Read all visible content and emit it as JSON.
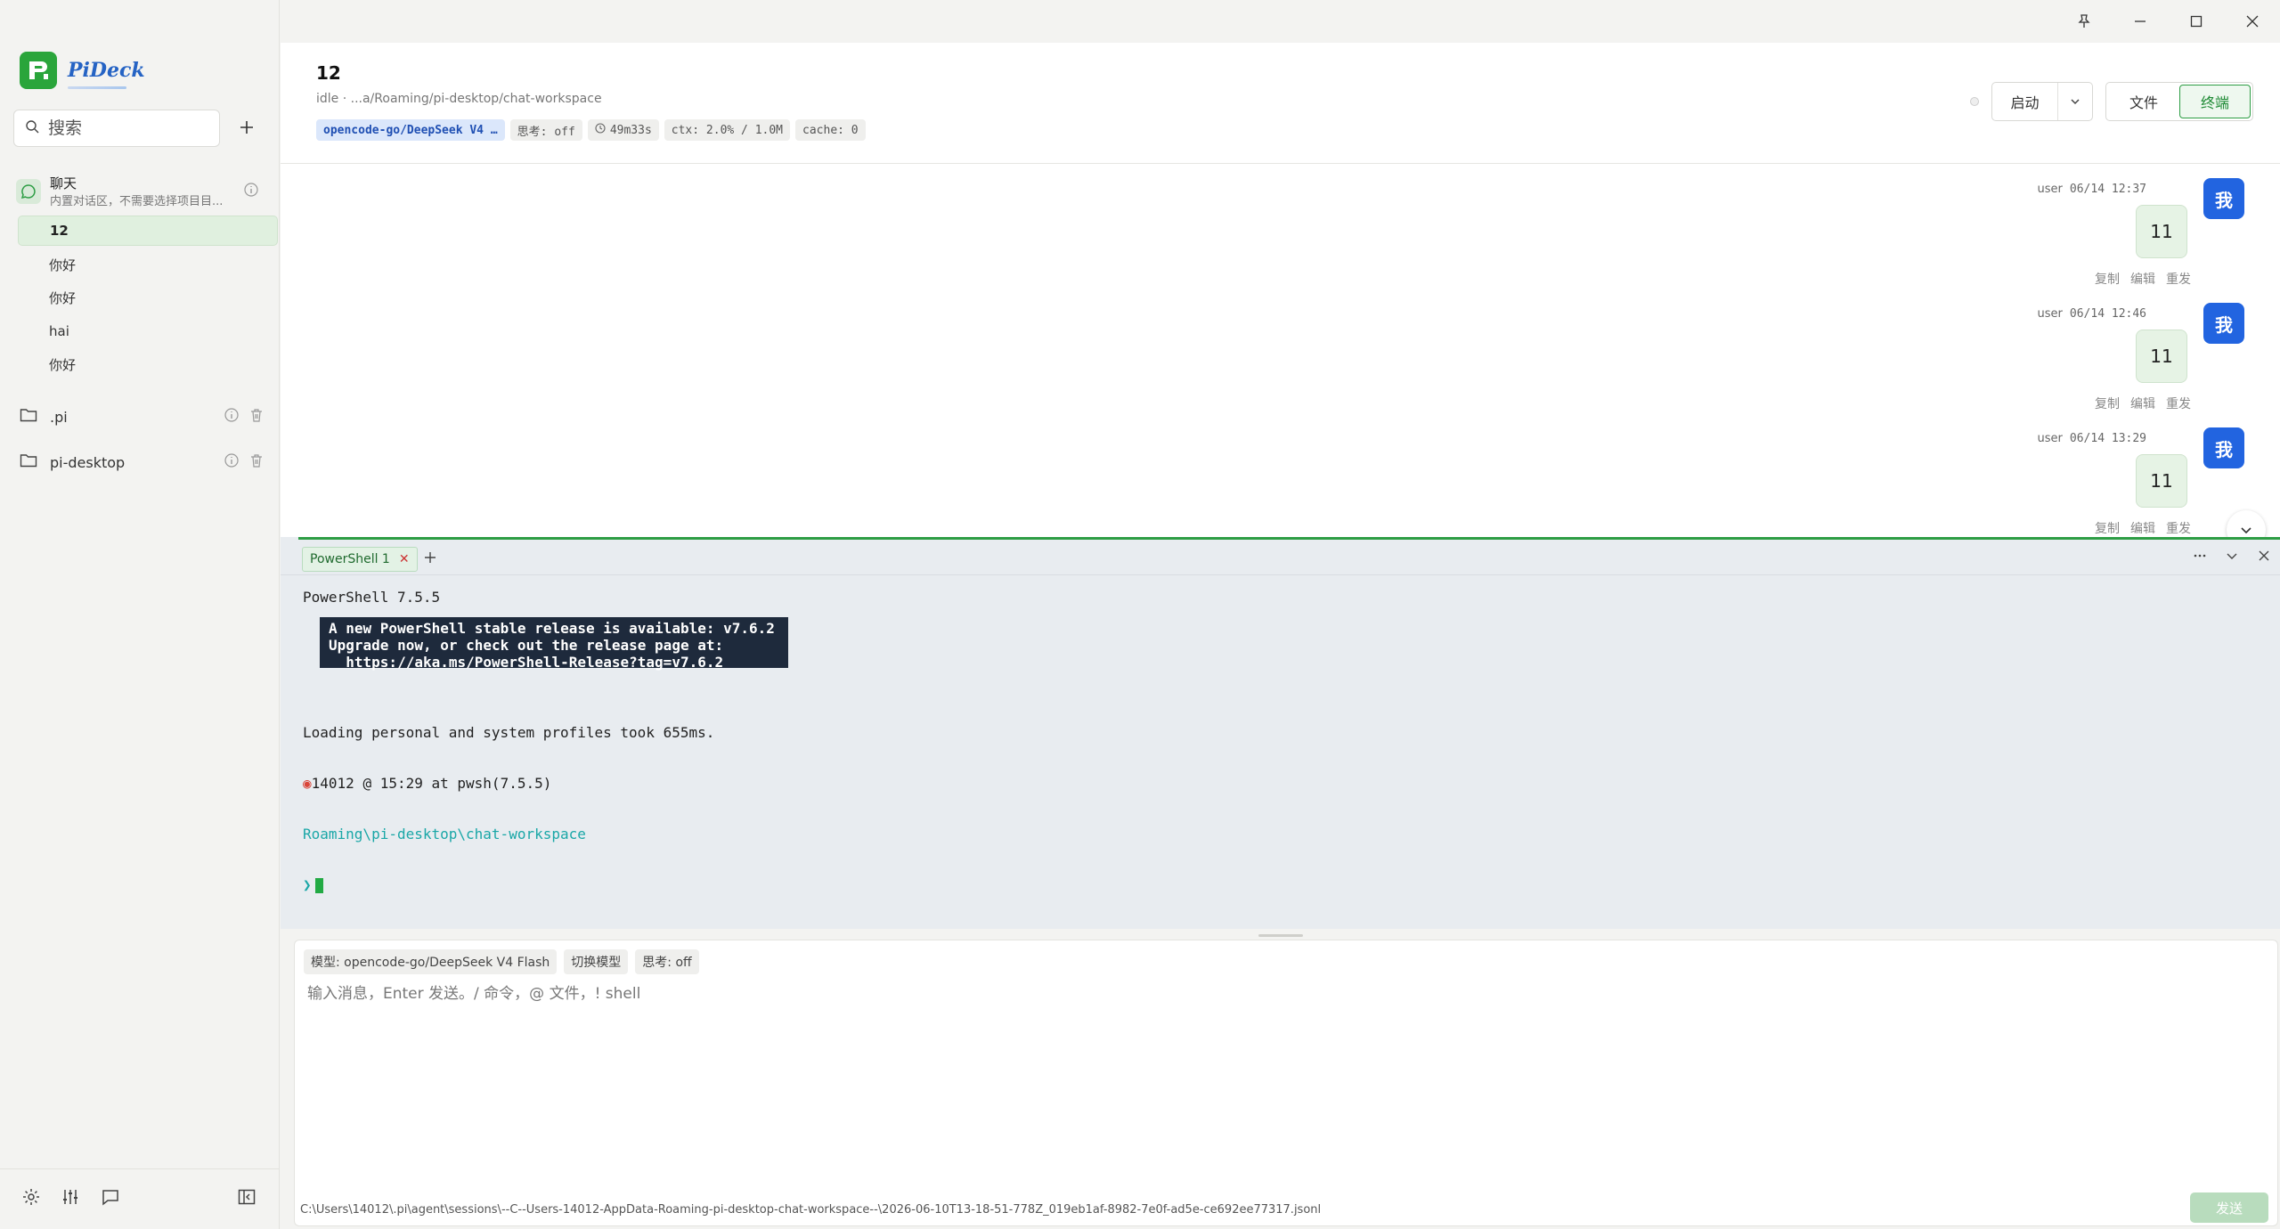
{
  "app": {
    "name": "PiDeck"
  },
  "sidebar": {
    "search_placeholder": "搜索",
    "chat_group": {
      "title": "聊天",
      "subtitle": "内置对话区，不需要选择项目目..."
    },
    "sessions": [
      {
        "label": "12",
        "active": true
      },
      {
        "label": "你好",
        "active": false
      },
      {
        "label": "你好",
        "active": false
      },
      {
        "label": "hai",
        "active": false
      },
      {
        "label": "你好",
        "active": false
      }
    ],
    "projects": [
      {
        "label": ".pi"
      },
      {
        "label": "pi-desktop"
      }
    ]
  },
  "header": {
    "title": "12",
    "path": "idle · ...a/Roaming/pi-desktop/chat-workspace",
    "chips": {
      "model": "opencode-go/DeepSeek V4 …",
      "thinking": "思考: off",
      "duration": "49m33s",
      "ctx": "ctx: 2.0% / 1.0M",
      "cache": "cache: 0"
    },
    "start_label": "启动",
    "tabs": {
      "files": "文件",
      "terminal": "终端"
    }
  },
  "messages": [
    {
      "role": "user",
      "time": "06/14 12:37",
      "text": "11",
      "avatar": "我"
    },
    {
      "role": "user",
      "time": "06/14 12:46",
      "text": "11",
      "avatar": "我"
    },
    {
      "role": "user",
      "time": "06/14 13:29",
      "text": "11",
      "avatar": "我"
    }
  ],
  "message_actions": {
    "copy": "复制",
    "edit": "编辑",
    "resend": "重发"
  },
  "terminal": {
    "tab_label": "PowerShell 1",
    "line_version": "PowerShell 7.5.5",
    "notice": "A new PowerShell stable release is available: v7.6.2\nUpgrade now, or check out the release page at:\n  https://aka.ms/PowerShell-Release?tag=v7.6.2",
    "line_loading": "Loading personal and system profiles took 655ms.",
    "line_prompt": "14012 @ 15:29 at pwsh(7.5.5)",
    "line_cwd": "Roaming\\pi-desktop\\chat-workspace",
    "prompt_symbol": "❯"
  },
  "composer": {
    "model_chip": "模型: opencode-go/DeepSeek V4 Flash",
    "switch_chip": "切换模型",
    "thinking_chip": "思考: off",
    "placeholder": "输入消息，Enter 发送。/ 命令，@ 文件，! shell",
    "session_path": "C:\\Users\\14012\\.pi\\agent\\sessions\\--C--Users-14012-AppData-Roaming-pi-desktop-chat-workspace--\\2026-06-10T13-18-51-778Z_019eb1af-8982-7e0f-ad5e-ce692ee77317.jsonl",
    "send_label": "发送"
  },
  "colors": {
    "accent": "#2d9d44",
    "avatar": "#2264e0",
    "model_chip": "#dbe7fb"
  }
}
